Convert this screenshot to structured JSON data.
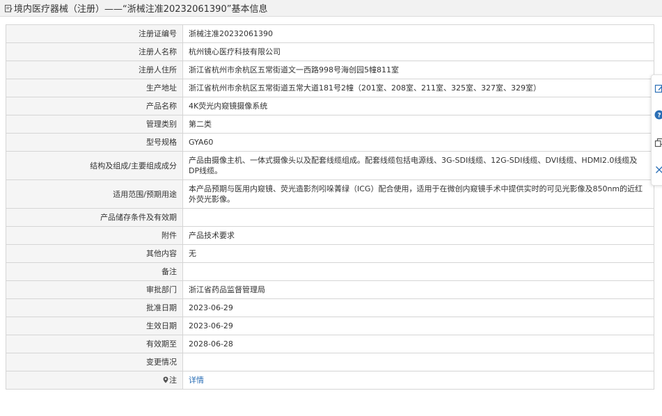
{
  "header": {
    "title": "境内医疗器械（注册）——“浙械注准20232061390”基本信息"
  },
  "rows": [
    {
      "label": "注册证编号",
      "value": "浙械注准20232061390"
    },
    {
      "label": "注册人名称",
      "value": "杭州镜心医疗科技有限公司"
    },
    {
      "label": "注册人住所",
      "value": "浙江省杭州市余杭区五常街道文一西路998号海创园5幢811室"
    },
    {
      "label": "生产地址",
      "value": "浙江省杭州市余杭区五常街道五常大道181号2幢（201室、208室、211室、325室、327室、329室）"
    },
    {
      "label": "产品名称",
      "value": "4K荧光内窥镜摄像系统"
    },
    {
      "label": "管理类别",
      "value": "第二类"
    },
    {
      "label": "型号规格",
      "value": "GYA60"
    },
    {
      "label": "结构及组成/主要组成成分",
      "value": "产品由摄像主机、一体式摄像头以及配套线缆组成。配套线缆包括电源线、3G-SDI线缆、12G-SDI线缆、DVI线缆、HDMI2.0线缆及DP线缆。"
    },
    {
      "label": "适用范围/预期用途",
      "value": "本产品预期与医用内窥镜、荧光造影剂吲哚菁绿（ICG）配合使用，适用于在微创内窥镜手术中提供实时的可见光影像及850nm的近红外荧光影像。"
    },
    {
      "label": "产品储存条件及有效期",
      "value": ""
    },
    {
      "label": "附件",
      "value": "产品技术要求"
    },
    {
      "label": "其他内容",
      "value": "无"
    },
    {
      "label": "备注",
      "value": ""
    },
    {
      "label": "审批部门",
      "value": "浙江省药品监督管理局"
    },
    {
      "label": "批准日期",
      "value": "2023-06-29"
    },
    {
      "label": "生效日期",
      "value": "2023-06-29"
    },
    {
      "label": "有效期至",
      "value": "2028-06-28"
    },
    {
      "label": "变更情况",
      "value": ""
    }
  ],
  "note_row": {
    "label": "注",
    "link": "详情"
  },
  "colors": {
    "header_bg": "#f2f2f2",
    "label_bg": "#f5f5f5",
    "border": "#d5d5d5",
    "link": "#2b6fb6",
    "sidebar_icon": "#2b6fb6"
  },
  "icons": {
    "header": "document-edit-icon",
    "note": "map-pin-icon",
    "sidebar": [
      "edit-icon",
      "help-icon",
      "copy-icon",
      "close-icon"
    ]
  }
}
